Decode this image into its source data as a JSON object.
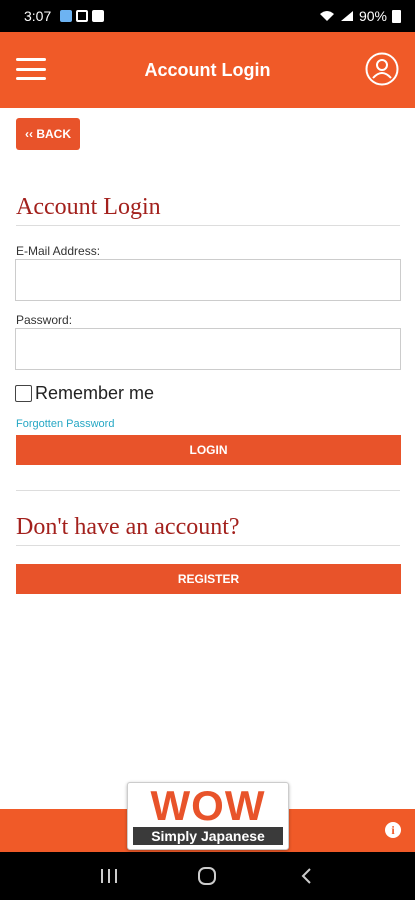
{
  "status_bar": {
    "time": "3:07",
    "battery": "90%"
  },
  "header": {
    "title": "Account Login"
  },
  "back_button": {
    "label": "‹‹ BACK"
  },
  "login_section": {
    "title": "Account Login",
    "email_label": "E-Mail Address:",
    "email_value": "",
    "password_label": "Password:",
    "password_value": "",
    "remember_label": "Remember me",
    "forgot_label": "Forgotten Password",
    "login_label": "LOGIN"
  },
  "register_section": {
    "title": "Don't have an account?",
    "register_label": "REGISTER"
  },
  "footer": {
    "logo_word": "WOW",
    "logo_tagline": "Simply Japanese",
    "info_icon": "info-icon"
  },
  "colors": {
    "brand": "#f05a28",
    "button": "#e8532a",
    "heading": "#a3211d",
    "link": "#26a7c4"
  }
}
